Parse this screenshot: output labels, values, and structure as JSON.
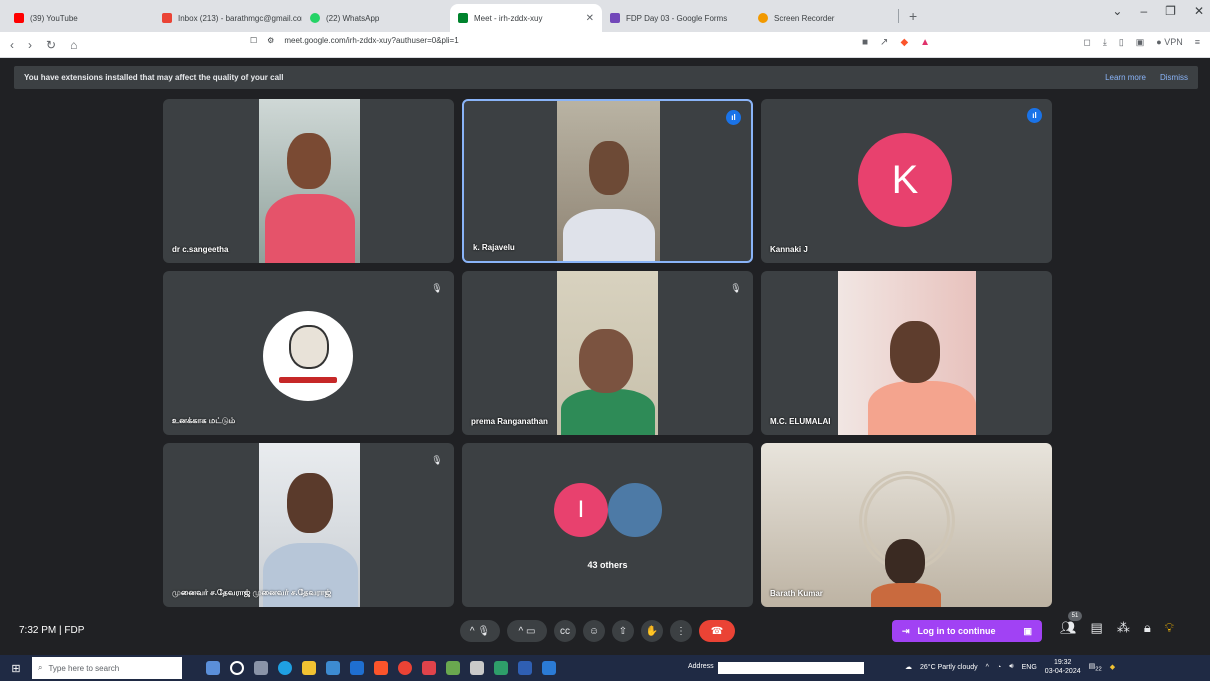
{
  "browser": {
    "tabs": [
      {
        "label": "(39) YouTube",
        "color": "#ff0000"
      },
      {
        "label": "Inbox (213) - barathmgc@gmail.com",
        "color": "#ea4335"
      },
      {
        "label": "(22) WhatsApp",
        "color": "#25d366"
      },
      {
        "label": "Meet - irh-zddx-xuy",
        "color": "#00832d",
        "active": true
      },
      {
        "label": "FDP Day 03 - Google Forms",
        "color": "#7248b9"
      },
      {
        "label": "Screen Recorder",
        "color": "#f29900"
      }
    ],
    "new_tab": "+",
    "url": "meet.google.com/irh-zddx-xuy?authuser=0&pli=1"
  },
  "banner": {
    "text": "You have extensions installed that may affect the quality of your call",
    "learn_more": "Learn more",
    "dismiss": "Dismiss"
  },
  "participants": [
    {
      "name": "dr c.sangeetha"
    },
    {
      "name": "k. Rajavelu"
    },
    {
      "name": "Kannaki J",
      "initial": "K"
    },
    {
      "name": "உனக்காக மட்டும்"
    },
    {
      "name": "prema Ranganathan"
    },
    {
      "name": "M.C. ELUMALAI"
    },
    {
      "name": "முனைவர் ச.தேவராஜ் முனைவர் ச.தேவராஜ்"
    },
    {
      "name": "",
      "initial": "I",
      "others": "43 others"
    },
    {
      "name": "Barath Kumar"
    }
  ],
  "meeting": {
    "time": "7:32 PM",
    "separator": "|",
    "code": "FDP",
    "participant_count": "51"
  },
  "extension": {
    "label": "Log in to continue"
  },
  "taskbar": {
    "search_placeholder": "Type here to search",
    "address_label": "Address",
    "weather": "26°C  Partly cloudy",
    "language": "ENG",
    "time": "19:32",
    "date": "03-04-2024",
    "notifications": "22"
  }
}
